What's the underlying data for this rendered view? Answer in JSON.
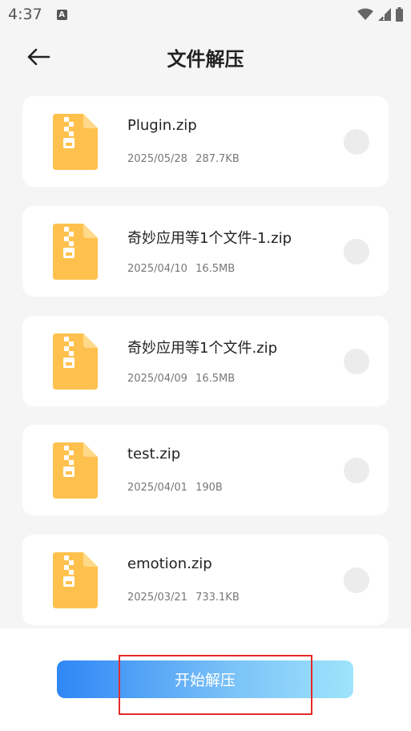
{
  "status_bar": {
    "time": "4:37",
    "app_icon_letter": "A"
  },
  "header": {
    "title": "文件解压"
  },
  "files": [
    {
      "name": "Plugin.zip",
      "date": "2025/05/28",
      "size": "287.7KB",
      "selected": false
    },
    {
      "name": "奇妙应用等1个文件-1.zip",
      "date": "2025/04/10",
      "size": "16.5MB",
      "selected": false
    },
    {
      "name": "奇妙应用等1个文件.zip",
      "date": "2025/04/09",
      "size": "16.5MB",
      "selected": false
    },
    {
      "name": "test.zip",
      "date": "2025/04/01",
      "size": "190B",
      "selected": false
    },
    {
      "name": "emotion.zip",
      "date": "2025/03/21",
      "size": "733.1KB",
      "selected": false
    }
  ],
  "bottom": {
    "start_label": "开始解压"
  },
  "colors": {
    "icon_yellow": "#ffc14d",
    "icon_fold": "#ffd98a",
    "highlight": "#e32a2a",
    "button_start": "#2f86f6",
    "button_end": "#9fe4fb"
  },
  "icons": {
    "back": "arrow-left-icon",
    "file": "zip-file-icon",
    "wifi": "wifi-icon",
    "signal": "signal-icon",
    "battery": "battery-icon"
  }
}
